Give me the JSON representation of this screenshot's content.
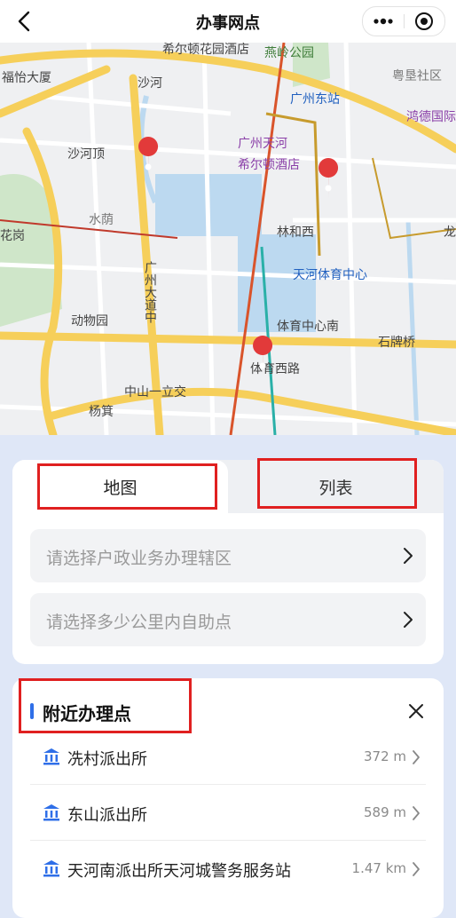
{
  "header": {
    "title": "办事网点"
  },
  "map": {
    "labels": [
      "希尔顿花园酒店",
      "燕岭公园",
      "福怡大厦",
      "沙河",
      "广州东站",
      "粤垦社区",
      "鸿德国际",
      "沙河顶",
      "广州天河",
      "希尔顿酒店",
      "水荫",
      "花岗",
      "林和西",
      "龙",
      "广州大道中",
      "天河体育中心",
      "动物园",
      "体育中心南",
      "石牌桥",
      "体育西路",
      "中山一立交",
      "杨箕"
    ]
  },
  "tabs": {
    "map_label": "地图",
    "list_label": "列表"
  },
  "filters": {
    "district_placeholder": "请选择户政业务办理辖区",
    "distance_placeholder": "请选择多少公里内自助点"
  },
  "nearby": {
    "title": "附近办理点",
    "items": [
      {
        "name": "冼村派出所",
        "distance": "372 m"
      },
      {
        "name": "东山派出所",
        "distance": "589 m"
      },
      {
        "name": "天河南派出所天河城警务服务站",
        "distance": "1.47 km"
      }
    ]
  },
  "colors": {
    "accent": "#2f6fe8",
    "highlight": "#e02020",
    "pin": "#e23a3a"
  }
}
